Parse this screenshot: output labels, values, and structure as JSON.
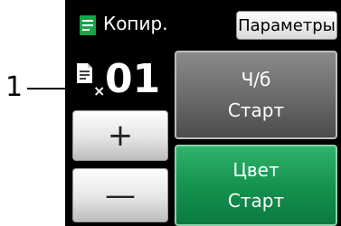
{
  "callout": {
    "number": "1"
  },
  "header": {
    "title": "Копир.",
    "params_label": "Параметры",
    "icon": "copy-document-icon"
  },
  "copies": {
    "times_sign": "×",
    "count": "01",
    "icon": "copy-sheet-icon"
  },
  "stepper": {
    "plus_label": "+",
    "minus_label": "—"
  },
  "mono_start": {
    "line1": "Ч/б",
    "line2": "Старт"
  },
  "color_start": {
    "line1": "Цвет",
    "line2": "Старт"
  },
  "colors": {
    "screen_bg": "#000000",
    "icon_green": "#1aa34a",
    "color_button": "#13904e",
    "mono_button": "#6c6c6c"
  }
}
